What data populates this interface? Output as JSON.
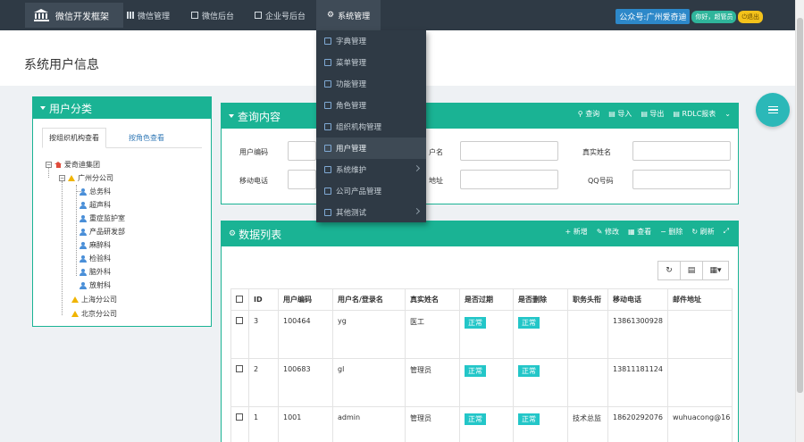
{
  "topbar": {
    "brand": "微信开发框架",
    "nav": [
      {
        "label": "微信管理"
      },
      {
        "label": "微信后台"
      },
      {
        "label": "企业号后台"
      },
      {
        "label": "系统管理"
      }
    ],
    "account": "公众号:广州爱奇迪",
    "welcome": "你好，超管员",
    "logout": "退出"
  },
  "page_title": "系统用户信息",
  "dropdown": {
    "items": [
      {
        "label": "字典管理",
        "submenu": false
      },
      {
        "label": "菜单管理",
        "submenu": false
      },
      {
        "label": "功能管理",
        "submenu": false
      },
      {
        "label": "角色管理",
        "submenu": false
      },
      {
        "label": "组织机构管理",
        "submenu": false
      },
      {
        "label": "用户管理",
        "submenu": false,
        "highlighted": true
      },
      {
        "label": "系统维护",
        "submenu": true
      },
      {
        "label": "公司产品管理",
        "submenu": false
      },
      {
        "label": "其他测试",
        "submenu": true
      }
    ]
  },
  "user_category": {
    "title": "用户分类",
    "tabs": [
      "按组织机构查看",
      "按角色查看"
    ],
    "tree": {
      "root": "爱奇迪集团",
      "companies": [
        "广州分公司",
        "上海分公司",
        "北京分公司"
      ],
      "departments": [
        "总务科",
        "超声科",
        "重症监护室",
        "产品研发部",
        "麻醉科",
        "检验科",
        "脑外科",
        "放射科"
      ]
    }
  },
  "query": {
    "title": "查询内容",
    "tools": [
      "查询",
      "导入",
      "导出",
      "RDLC报表"
    ],
    "fields": {
      "user_code": "用户编码",
      "username": "户名",
      "real_name": "真实姓名",
      "mobile": "移动电话",
      "address": "地址",
      "qq": "QQ号码"
    }
  },
  "data_list": {
    "title": "数据列表",
    "tools": [
      "新增",
      "修改",
      "查看",
      "删除",
      "刷新"
    ],
    "columns": [
      "ID",
      "用户编码",
      "用户名/登录名",
      "真实姓名",
      "是否过期",
      "是否删除",
      "职务头衔",
      "移动电话",
      "邮件地址"
    ],
    "rows": [
      {
        "id": "3",
        "code": "100464",
        "login": "yg",
        "name": "医工",
        "expired": "正常",
        "deleted": "正常",
        "title": "",
        "mobile": "13861300928",
        "email": ""
      },
      {
        "id": "2",
        "code": "100683",
        "login": "gl",
        "name": "管理员",
        "expired": "正常",
        "deleted": "正常",
        "title": "",
        "mobile": "13811181124",
        "email": ""
      },
      {
        "id": "1",
        "code": "1001",
        "login": "admin",
        "name": "管理员",
        "expired": "正常",
        "deleted": "正常",
        "title": "技术总监",
        "mobile": "18620292076",
        "email": "wuhuacong@16"
      }
    ]
  },
  "colors": {
    "accent": "#1ab394",
    "topbar": "#2f3a45",
    "tag": "#23c6c8",
    "fab": "#2bb8b8"
  }
}
